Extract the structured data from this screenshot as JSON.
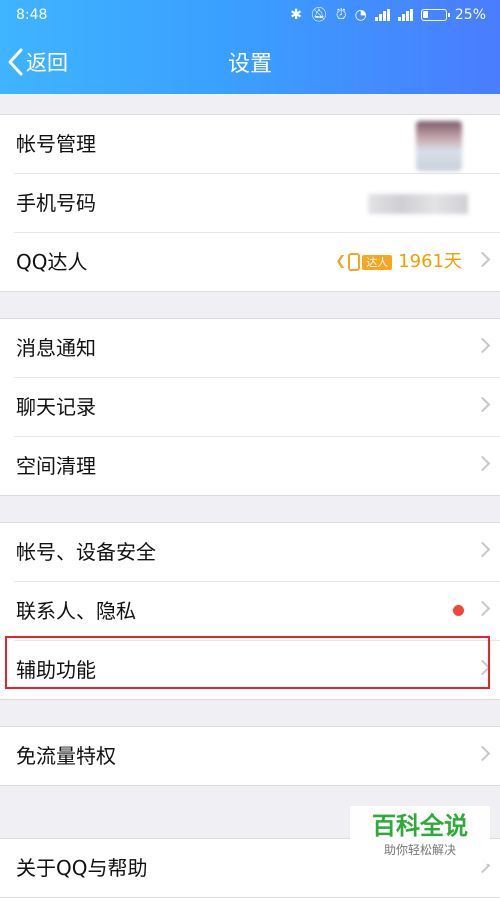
{
  "status_bar": {
    "time": "8:48",
    "battery": "25%",
    "battery_level": 0.25,
    "icons": [
      "bluetooth-icon",
      "mute-icon",
      "alarm-icon",
      "wifi-icon",
      "signal-icon",
      "signal-icon",
      "battery-icon"
    ]
  },
  "nav": {
    "back_label": "返回",
    "title": "设置"
  },
  "group1": {
    "account": "帐号管理",
    "phone": "手机号码",
    "qq_daren": "QQ达人",
    "daren_tag": "达人",
    "daren_days": "1961天"
  },
  "group2": {
    "notifications": "消息通知",
    "chat_history": "聊天记录",
    "storage": "空间清理"
  },
  "group3": {
    "security": "帐号、设备安全",
    "privacy": "联系人、隐私",
    "accessibility": "辅助功能"
  },
  "group4": {
    "free_data": "免流量特权"
  },
  "group5": {
    "about": "关于QQ与帮助"
  },
  "watermark": {
    "title": "百科全说",
    "subtitle": "助你轻松解决"
  },
  "colors": {
    "header_start": "#3fb4ff",
    "header_end": "#4a7cff",
    "highlight": "#e4252f",
    "badge": "#f5a623",
    "red_dot": "#f2463a"
  }
}
